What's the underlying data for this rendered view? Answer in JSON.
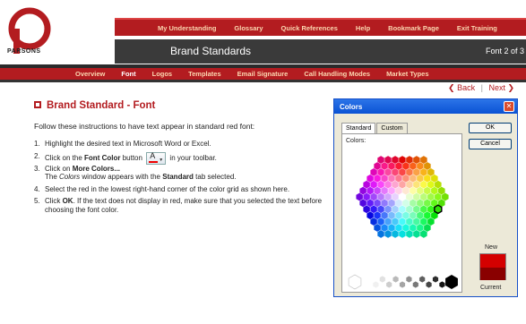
{
  "logo": {
    "text": "PARSONS"
  },
  "topnav": {
    "items": [
      "My Understanding",
      "Glossary",
      "Quick References",
      "Help",
      "Bookmark Page",
      "Exit Training"
    ]
  },
  "header": {
    "title": "Brand Standards",
    "page": "Font 2 of 3"
  },
  "subnav": {
    "items": [
      "Overview",
      "Font",
      "Logos",
      "Templates",
      "Email Signature",
      "Call Handling Modes",
      "Market Types"
    ],
    "active": "Font"
  },
  "nav": {
    "back": "Back",
    "separator": "|",
    "next": "Next"
  },
  "content": {
    "heading": "Brand Standard - Font",
    "intro": "Follow these instructions to have text appear in standard red font:",
    "steps": [
      {
        "num": "1.",
        "text": "Highlight the desired text in Microsoft Word or Excel."
      },
      {
        "num": "2.",
        "pre": "Click on the",
        "bold": "Font Color",
        "mid": "button",
        "post": "in your toolbar."
      },
      {
        "num": "3.",
        "pre": "Click on",
        "bold": "More Colors...",
        "sub_italic": "Colors",
        "sub_pre": "The",
        "sub_mid": "window appears with the",
        "sub_bold": "Standard",
        "sub_post": "tab selected."
      },
      {
        "num": "4.",
        "text": "Select the red in the lowest right-hand corner of the color grid as shown here."
      },
      {
        "num": "5.",
        "pre": "Click",
        "bold": "OK",
        "post": ". If the text does not display in red, make sure that you selected the text before choosing the font color."
      }
    ]
  },
  "dialog": {
    "title": "Colors",
    "close": "✕",
    "tabs": [
      "Standard",
      "Custom"
    ],
    "colors_label": "Colors:",
    "ok": "OK",
    "cancel": "Cancel",
    "new_label": "New",
    "current_label": "Current",
    "new_color": "#d40000",
    "current_color": "#8a0000"
  },
  "colors": {
    "brand_red": "#b31c20",
    "dark": "#3a3a3a"
  }
}
